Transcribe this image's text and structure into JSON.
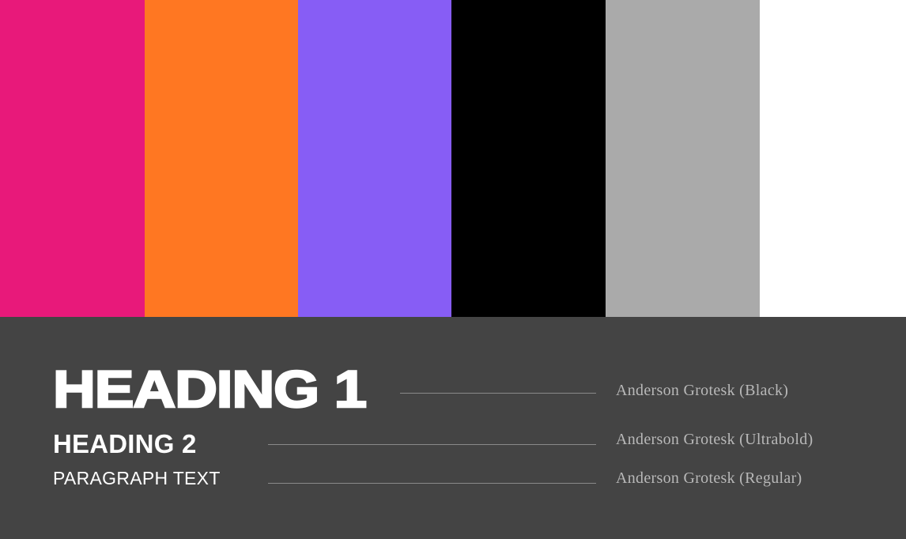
{
  "palette": {
    "colors": [
      "#E8197A",
      "#FF7722",
      "#875DF5",
      "#000000",
      "#AAAAAA",
      "#FFFFFF"
    ]
  },
  "typography": {
    "heading_1": {
      "sample": "HEADING 1",
      "font": "Anderson Grotesk (Black)"
    },
    "heading_2": {
      "sample": "HEADING 2",
      "font": "Anderson Grotesk (Ultrabold)"
    },
    "paragraph": {
      "sample": "PARAGRAPH TEXT",
      "font": "Anderson Grotesk (Regular)"
    }
  }
}
